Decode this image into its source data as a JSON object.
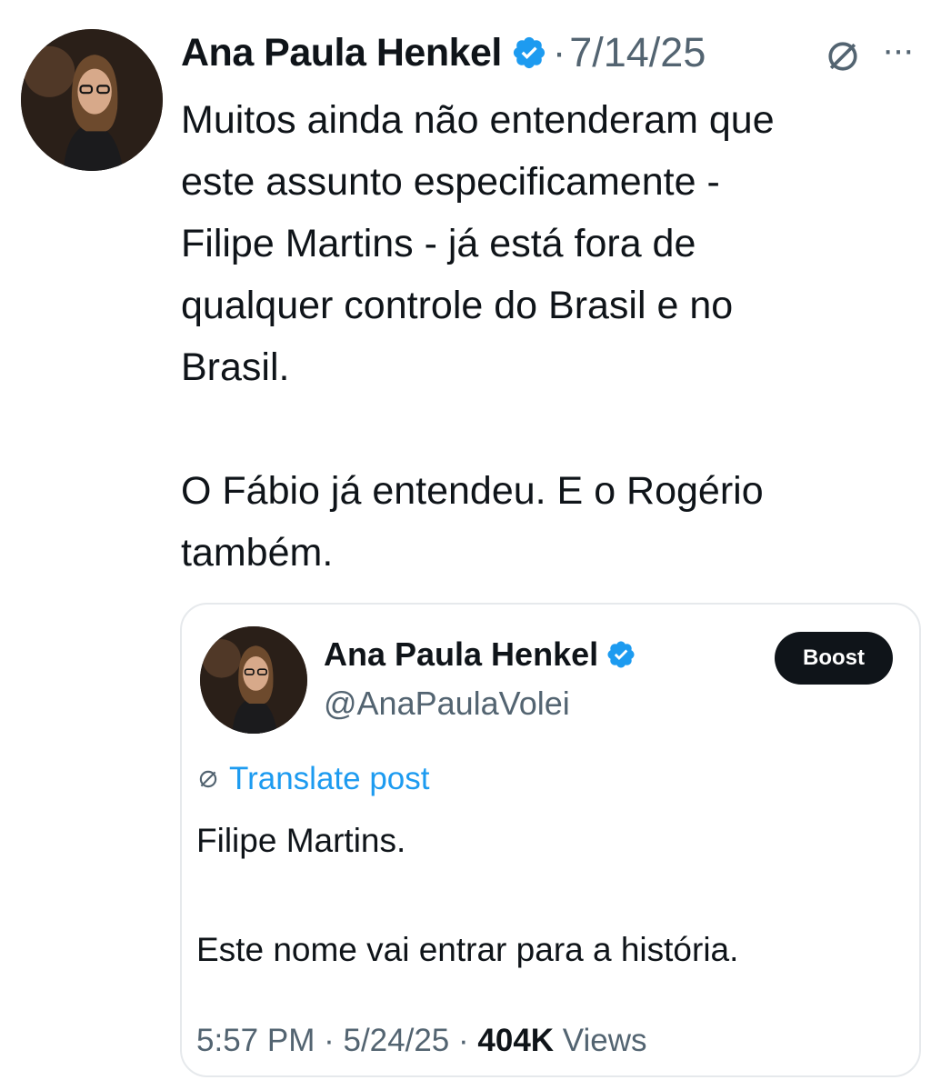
{
  "tweet": {
    "author_name": "Ana Paula Henkel",
    "separator": "·",
    "date": "7/14/25",
    "text": "Muitos ainda não entenderam que\neste assunto especificamente -\nFilipe Martins - já está fora de\nqualquer controle do Brasil e no\nBrasil.\n\nO Fábio já entendeu. E o Rogério\ntambém.",
    "more_label": "···"
  },
  "quote": {
    "author_name": "Ana Paula Henkel",
    "handle": "@AnaPaulaVolei",
    "boost_label": "Boost",
    "translate_label": "Translate post",
    "text": "Filipe Martins.\n\nEste nome vai entrar para a história.",
    "time": "5:57 PM",
    "sep1": "·",
    "date": "5/24/25",
    "sep2": "·",
    "views_count": "404K",
    "views_label": "Views"
  },
  "colors": {
    "accent": "#1d9bf0",
    "text": "#0f1419",
    "muted": "#536471",
    "border": "#e6e9ec"
  },
  "icons": [
    "verified-badge-icon",
    "globe-icon",
    "more-icon",
    "avatar"
  ]
}
